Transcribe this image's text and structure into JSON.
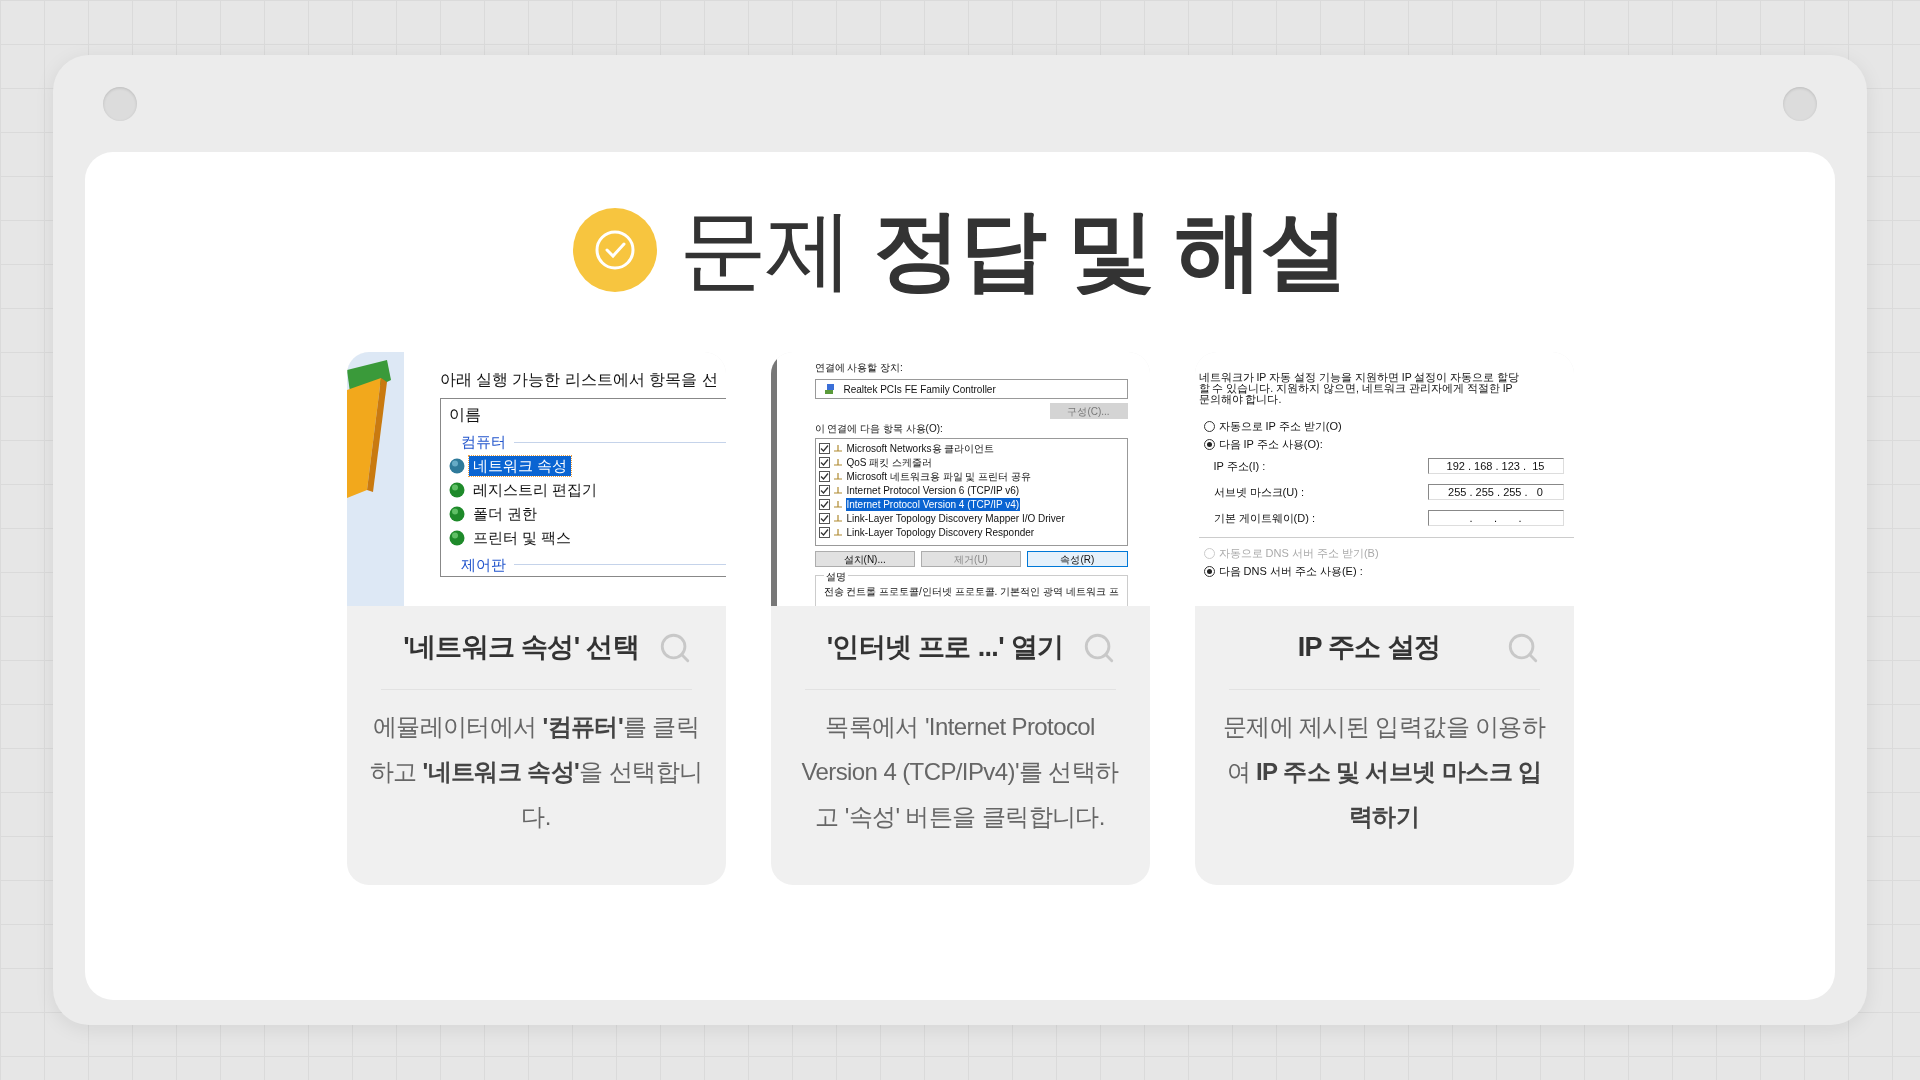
{
  "title": "문제 **정답 및 해설**",
  "cards": [
    {
      "heading": "'네트워크 속성' 선택",
      "description": "에뮬레이터에서 **'컴퓨터'**를 클릭하고 **'네트워크 속성'**을 선택합니다.",
      "screenshot": {
        "kind": "program_list",
        "instruction": "아래 실행 가능한 리스트에서 항목을 선",
        "column": "이름",
        "groups": [
          {
            "label": "컴퓨터",
            "items": [
              {
                "label": "네트워크 속성",
                "selected": true
              },
              {
                "label": "레지스트리 편집기",
                "selected": false
              },
              {
                "label": "폴더 권한",
                "selected": false
              },
              {
                "label": "프린터 및 팩스",
                "selected": false
              }
            ]
          },
          {
            "label": "제어판"
          }
        ]
      }
    },
    {
      "heading": "'인터넷 프로 ...' 열기",
      "description": "목록에서 'Internet Protocol Version 4 (TCP/IPv4)'를 선택하고 '속성' 버튼을 클릭합니다.",
      "screenshot": {
        "kind": "adapter_properties",
        "device_label": "연결에 사용할 장치:",
        "device": "Realtek PCIs FE Family Controller",
        "configure_button": "구성(C)...",
        "items_label": "이 연결에 다음 항목 사용(O):",
        "items": [
          {
            "label": "Microsoft Networks용 클라이언트",
            "checked": true,
            "selected": false
          },
          {
            "label": "QoS 패킷 스케줄러",
            "checked": true,
            "selected": false
          },
          {
            "label": "Microsoft 네트워크용 파일 및 프린터 공유",
            "checked": true,
            "selected": false
          },
          {
            "label": "Internet Protocol Version 6 (TCP/IP v6)",
            "checked": true,
            "selected": false
          },
          {
            "label": "Internet Protocol Version 4 (TCP/IP v4)",
            "checked": true,
            "selected": true
          },
          {
            "label": "Link-Layer Topology Discovery Mapper I/O Driver",
            "checked": true,
            "selected": false
          },
          {
            "label": "Link-Layer Topology Discovery Responder",
            "checked": true,
            "selected": false
          }
        ],
        "buttons": [
          {
            "label": "설치(N)...",
            "disabled": false,
            "selected": false
          },
          {
            "label": "제거(U)",
            "disabled": true,
            "selected": false
          },
          {
            "label": "속성(R)",
            "disabled": false,
            "selected": true
          }
        ],
        "description_label": "설명",
        "description": "전송 컨트롤 프로토콜/인터넷 프로토콜. 기본적인 광역 네트워크 프"
      }
    },
    {
      "heading": "IP 주소 설정",
      "description": "문제에 제시된 입력값을 이용하여 **IP 주소 및 서브넷 마스크 입력하기**",
      "screenshot": {
        "kind": "ip_settings",
        "intro": [
          "네트워크가 IP 자동 설정 기능을 지원하면 IP 설정이 자동으로 할당",
          "할 수 있습니다. 지원하지 않으면, 네트워크 관리자에게 적절한 IP",
          "문의해야 합니다."
        ],
        "ip_radios": [
          {
            "label": "자동으로 IP 주소 받기(O)",
            "selected": false,
            "disabled": false
          },
          {
            "label": "다음 IP 주소 사용(O):",
            "selected": true,
            "disabled": false
          }
        ],
        "fields": [
          {
            "label": "IP 주소(I) :",
            "value": "192 . 168 . 123 .  15"
          },
          {
            "label": "서브넷 마스크(U) :",
            "value": "255 . 255 . 255 .   0"
          },
          {
            "label": "기본 게이트웨이(D) :",
            "value": ".       .       ."
          }
        ],
        "dns_radios": [
          {
            "label": "자동으로 DNS 서버 주소 받기(B)",
            "selected": false,
            "disabled": true
          },
          {
            "label": "다음 DNS 서버 주소 사용(E) :",
            "selected": true,
            "disabled": false
          }
        ]
      }
    }
  ]
}
